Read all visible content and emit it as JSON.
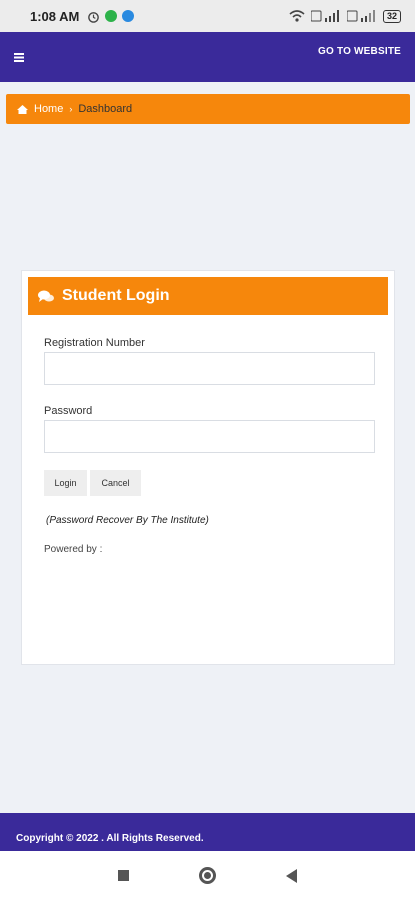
{
  "status_bar": {
    "time": "1:08 AM",
    "battery": "32",
    "icons": [
      "alarm-icon",
      "app-badge-icon",
      "notification-icon",
      "wifi-icon",
      "signal-icon",
      "battery-icon"
    ]
  },
  "header": {
    "menu_icon": "hamburger-icon",
    "go_to_website": "GO TO WEBSITE",
    "color": "#3a2a9a"
  },
  "breadcrumb": {
    "home": "Home",
    "separator": "›",
    "current": "Dashboard",
    "color": "#f6870c"
  },
  "login_card": {
    "title": "Student Login",
    "title_icon": "chat-bubbles-icon",
    "registration_label": "Registration Number",
    "registration_value": "",
    "password_label": "Password",
    "password_value": "",
    "login_button": "Login",
    "cancel_button": "Cancel",
    "recover_note": "(Password Recover By The Institute)",
    "powered_by": "Powered by :"
  },
  "footer": {
    "copyright": "Copyright © 2022 . All Rights Reserved."
  },
  "nav_bar": {
    "icons": [
      "recents-square-icon",
      "home-circle-icon",
      "back-triangle-icon"
    ]
  }
}
